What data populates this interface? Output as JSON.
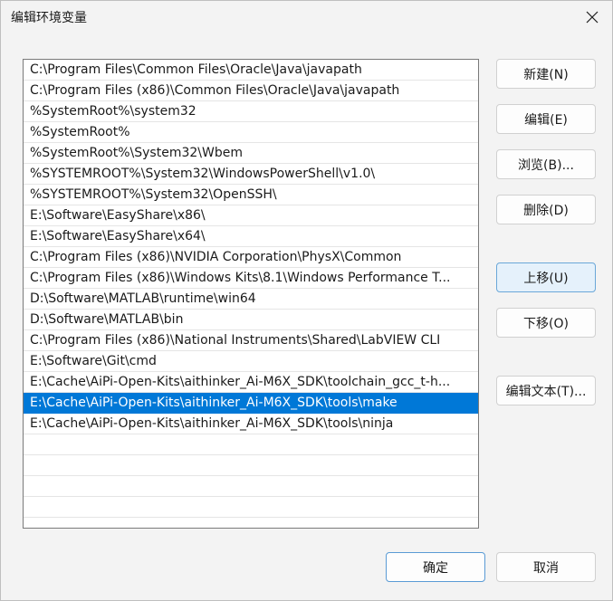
{
  "dialog": {
    "title": "编辑环境变量"
  },
  "paths": [
    "C:\\Program Files\\Common Files\\Oracle\\Java\\javapath",
    "C:\\Program Files (x86)\\Common Files\\Oracle\\Java\\javapath",
    "%SystemRoot%\\system32",
    "%SystemRoot%",
    "%SystemRoot%\\System32\\Wbem",
    "%SYSTEMROOT%\\System32\\WindowsPowerShell\\v1.0\\",
    "%SYSTEMROOT%\\System32\\OpenSSH\\",
    "E:\\Software\\EasyShare\\x86\\",
    "E:\\Software\\EasyShare\\x64\\",
    "C:\\Program Files (x86)\\NVIDIA Corporation\\PhysX\\Common",
    "C:\\Program Files (x86)\\Windows Kits\\8.1\\Windows Performance T...",
    "D:\\Software\\MATLAB\\runtime\\win64",
    "D:\\Software\\MATLAB\\bin",
    "C:\\Program Files (x86)\\National Instruments\\Shared\\LabVIEW CLI",
    "E:\\Software\\Git\\cmd",
    "E:\\Cache\\AiPi-Open-Kits\\aithinker_Ai-M6X_SDK\\toolchain_gcc_t-h...",
    "E:\\Cache\\AiPi-Open-Kits\\aithinker_Ai-M6X_SDK\\tools\\make",
    "E:\\Cache\\AiPi-Open-Kits\\aithinker_Ai-M6X_SDK\\tools\\ninja"
  ],
  "selected_index": 16,
  "buttons": {
    "new": "新建(N)",
    "edit": "编辑(E)",
    "browse": "浏览(B)...",
    "delete": "删除(D)",
    "move_up": "上移(U)",
    "move_down": "下移(O)",
    "edit_text": "编辑文本(T)...",
    "ok": "确定",
    "cancel": "取消"
  },
  "colors": {
    "selection": "#0078d7",
    "dialog_bg": "#f3f3f3"
  }
}
